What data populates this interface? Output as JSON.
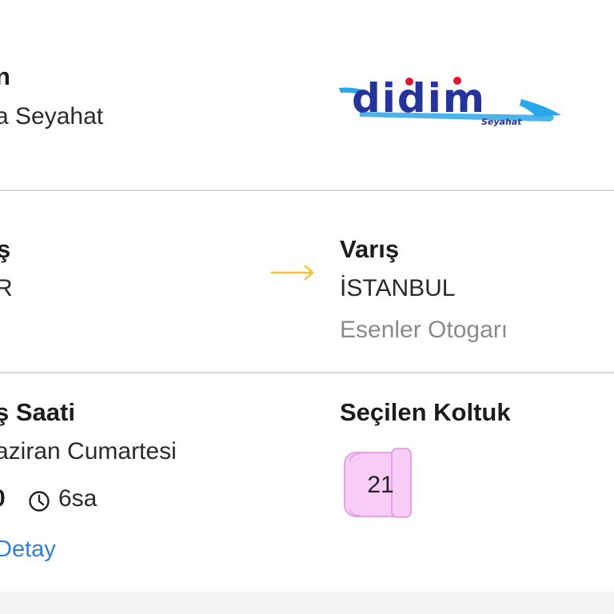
{
  "company": {
    "title_fragment": "n",
    "name_fragment": "a Seyahat",
    "logo_text": "didim",
    "logo_subtext": "Seyahat",
    "brand_colors": {
      "primary": "#25349a",
      "accent": "#2aa7e8",
      "highlight": "#e0162b"
    }
  },
  "route": {
    "departure_label_fragment": "ş",
    "departure_city_fragment": "R",
    "arrival_label": "Varış",
    "arrival_city": "İSTANBUL",
    "arrival_terminal": "Esenler Otogarı",
    "arrow_icon": "arrow-right-icon",
    "arrow_color": "#f2c230"
  },
  "trip": {
    "time_label_fragment": "ş Saati",
    "date_fragment": "aziran Cumartesi",
    "time_fragment": "0",
    "duration": "6sa",
    "duration_icon": "clock-icon",
    "details_link_fragment": "Detay"
  },
  "seat": {
    "label": "Seçilen Koltuk",
    "number": "21",
    "seat_color": "#f7cdf7",
    "seat_border": "#e08fe0"
  }
}
